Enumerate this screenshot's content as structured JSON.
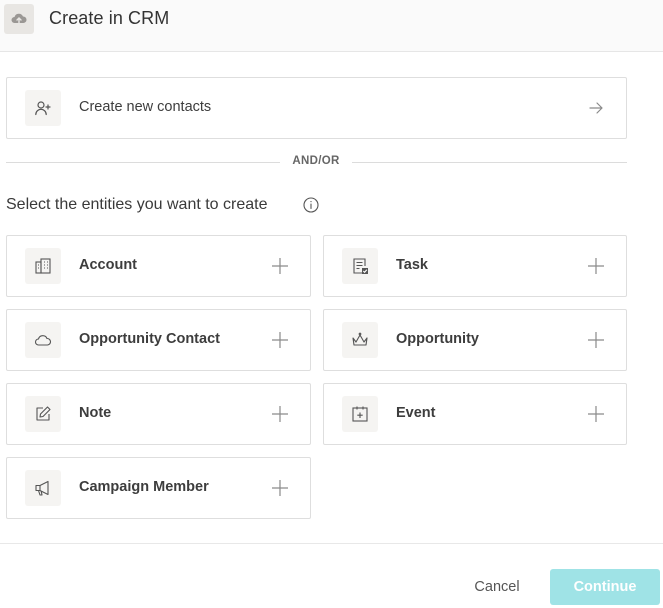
{
  "header": {
    "title": "Create in CRM",
    "icon": "cloud-upload-icon"
  },
  "contacts_card": {
    "label": "Create new contacts",
    "icon": "add-user-icon",
    "action_icon": "arrow-right-icon"
  },
  "divider": {
    "label": "AND/OR"
  },
  "section": {
    "title": "Select the entities you want to create",
    "info_icon": "info-icon"
  },
  "entities": [
    {
      "label": "Account",
      "icon": "building-icon"
    },
    {
      "label": "Task",
      "icon": "task-check-icon"
    },
    {
      "label": "Opportunity Contact",
      "icon": "cloud-icon"
    },
    {
      "label": "Opportunity",
      "icon": "crown-icon"
    },
    {
      "label": "Note",
      "icon": "edit-icon"
    },
    {
      "label": "Event",
      "icon": "calendar-add-icon"
    },
    {
      "label": "Campaign Member",
      "icon": "megaphone-icon"
    }
  ],
  "footer": {
    "cancel_label": "Cancel",
    "continue_label": "Continue"
  },
  "colors": {
    "accent_disabled": "#9fe3e6",
    "border": "#dedede",
    "icon_bg": "#f5f4f2"
  }
}
